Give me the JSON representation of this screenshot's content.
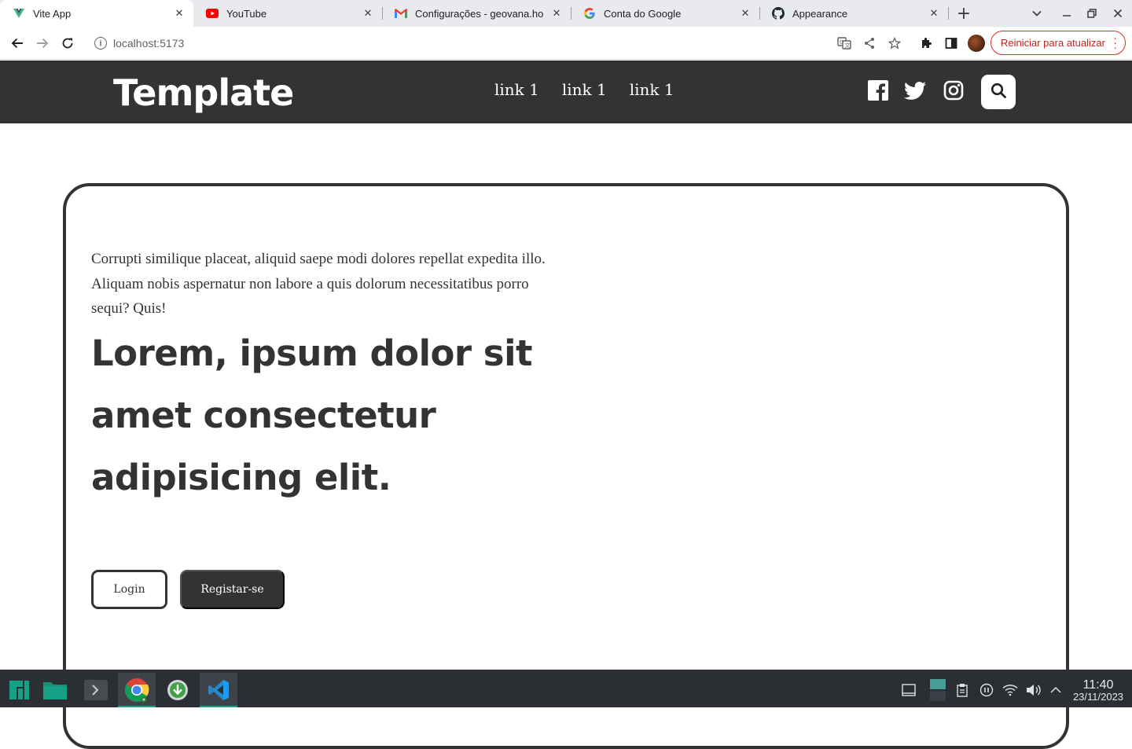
{
  "browser": {
    "tabs": [
      {
        "title": "Vite App",
        "icon": "vite-icon",
        "active": true
      },
      {
        "title": "YouTube",
        "icon": "youtube-icon",
        "active": false
      },
      {
        "title": "Configurações - geovana.ho",
        "icon": "gmail-icon",
        "active": false
      },
      {
        "title": "Conta do Google",
        "icon": "google-icon",
        "active": false
      },
      {
        "title": "Appearance",
        "icon": "github-icon",
        "active": false
      }
    ],
    "url": "localhost:5173",
    "update_button": "Reiniciar para atualizar"
  },
  "site": {
    "logo": "Template",
    "nav": [
      "link 1",
      "link 1",
      "link 1"
    ],
    "social_icons": [
      "facebook-icon",
      "twitter-icon",
      "instagram-icon"
    ],
    "intro": "Corrupti similique placeat, aliquid saepe modi dolores repellat expedita illo. Aliquam nobis aspernatur non labore a quis dolorum necessitatibus porro sequi? Quis!",
    "headline": "Lorem, ipsum dolor sit amet consectetur adipisicing elit.",
    "login_label": "Login",
    "register_label": "Registar-se",
    "colors": {
      "primary": "#333333",
      "background": "#ffffff"
    }
  },
  "taskbar": {
    "time": "11:40",
    "date": "23/11/2023"
  }
}
